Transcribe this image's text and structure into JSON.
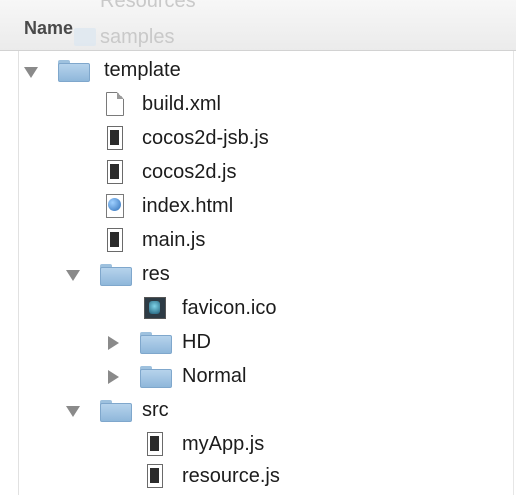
{
  "header": {
    "name_label": "Name",
    "ghost_above": "Resources",
    "ghost_samples": "samples"
  },
  "tree": {
    "template": {
      "label": "template",
      "expanded": true
    },
    "files_template": [
      {
        "label": "build.xml",
        "icon": "document-icon"
      },
      {
        "label": "cocos2d-jsb.js",
        "icon": "js-file-icon"
      },
      {
        "label": "cocos2d.js",
        "icon": "js-file-icon"
      },
      {
        "label": "index.html",
        "icon": "html-file-icon"
      },
      {
        "label": "main.js",
        "icon": "js-file-icon"
      }
    ],
    "res": {
      "label": "res",
      "expanded": true
    },
    "favicon": {
      "label": "favicon.ico",
      "icon": "ico-file-icon"
    },
    "hd": {
      "label": "HD",
      "expanded": false
    },
    "normal": {
      "label": "Normal",
      "expanded": false
    },
    "src": {
      "label": "src",
      "expanded": true
    },
    "files_src": [
      {
        "label": "myApp.js",
        "icon": "js-file-icon"
      },
      {
        "label": "resource.js",
        "icon": "js-file-icon"
      }
    ]
  },
  "colors": {
    "folder": "#9ec1de",
    "triangle": "#8a8a8a",
    "text": "#1c1c1c"
  }
}
